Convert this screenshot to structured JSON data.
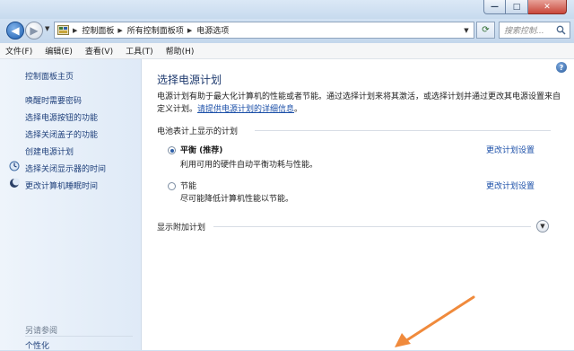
{
  "window": {
    "minimize_glyph": "—",
    "maximize_glyph": "□",
    "close_glyph": "✕"
  },
  "address_bar": {
    "breadcrumbs": [
      "控制面板",
      "所有控制面板项",
      "电源选项"
    ],
    "search_placeholder": "搜索控制..."
  },
  "menu": {
    "items": [
      "文件(F)",
      "编辑(E)",
      "查看(V)",
      "工具(T)",
      "帮助(H)"
    ]
  },
  "sidebar": {
    "home": "控制面板主页",
    "links": [
      "唤醒时需要密码",
      "选择电源按钮的功能",
      "选择关闭盖子的功能",
      "创建电源计划"
    ],
    "icon_links": [
      {
        "label": "选择关闭显示器的时间",
        "icon": "display-icon"
      },
      {
        "label": "更改计算机睡眠时间",
        "icon": "moon-icon"
      }
    ],
    "see_also": "另请参阅",
    "see_also_links": [
      "个性化"
    ]
  },
  "main": {
    "help_glyph": "?",
    "title": "选择电源计划",
    "description": "电源计划有助于最大化计算机的性能或者节能。通过选择计划来将其激活，或选择计划并通过更改其电源设置来自定义计划。",
    "description_link": "请提供电源计划的详细信息",
    "description_end": "。",
    "group_header": "电池表计上显示的计划",
    "plans": [
      {
        "name": "平衡 (推荐)",
        "desc": "利用可用的硬件自动平衡功耗与性能。",
        "link": "更改计划设置",
        "selected": true
      },
      {
        "name": "节能",
        "desc": "尽可能降低计算机性能以节能。",
        "link": "更改计划设置",
        "selected": false
      }
    ],
    "more_plans": "显示附加计划"
  },
  "colors": {
    "link": "#1b4fa8",
    "title": "#1e3a6e",
    "annotation_arrow": "#f08a3c"
  }
}
